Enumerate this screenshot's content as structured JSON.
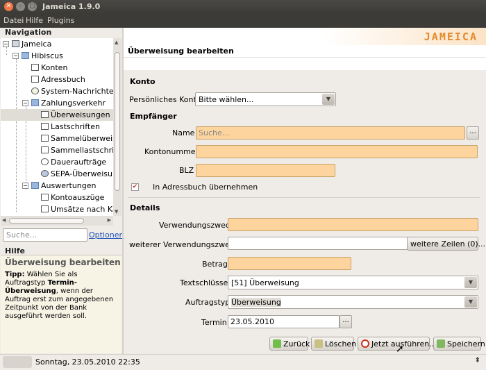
{
  "window": {
    "title": "Jameica 1.9.0"
  },
  "menu": [
    "Datei",
    "Hilfe",
    "Plugins"
  ],
  "navigation": {
    "heading": "Navigation",
    "tree": [
      {
        "label": "Jameica",
        "level": 0,
        "icon": "computer-icon"
      },
      {
        "label": "Hibiscus",
        "level": 1,
        "icon": "folder-icon"
      },
      {
        "label": "Konten",
        "level": 2,
        "icon": "accounts-icon"
      },
      {
        "label": "Adressbuch",
        "level": 2,
        "icon": "addressbook-icon"
      },
      {
        "label": "System-Nachrichten",
        "level": 2,
        "icon": "bulb-icon"
      },
      {
        "label": "Zahlungsverkehr",
        "level": 2,
        "icon": "folder-icon"
      },
      {
        "label": "Überweisungen",
        "level": 3,
        "icon": "transfer-icon",
        "selected": true
      },
      {
        "label": "Lastschriften",
        "level": 3,
        "icon": "debit-icon"
      },
      {
        "label": "Sammelüberweisungen",
        "level": 3,
        "icon": "collective-transfer-icon"
      },
      {
        "label": "Sammellastschriften",
        "level": 3,
        "icon": "collective-debit-icon"
      },
      {
        "label": "Daueraufträge",
        "level": 3,
        "icon": "clock-icon"
      },
      {
        "label": "SEPA-Überweisungen",
        "level": 3,
        "icon": "sepa-icon"
      },
      {
        "label": "Auswertungen",
        "level": 2,
        "icon": "folder-icon"
      },
      {
        "label": "Kontoauszüge",
        "level": 3,
        "icon": "statement-icon"
      },
      {
        "label": "Umsätze nach Kategorien",
        "level": 3,
        "icon": "revenue-icon"
      }
    ],
    "search_placeholder": "Suche...",
    "options_label": "Optionen"
  },
  "help": {
    "heading": "Hilfe",
    "title": "Überweisung bearbeiten",
    "tip_label": "Tipp:",
    "tip_text_1": " Wählen Sie als Auftragstyp ",
    "tip_bold": "Termin-Überweisung",
    "tip_text_2": ", wenn der Auftrag erst zum angegebenen Zeitpunkt von der Bank ausgeführt werden soll."
  },
  "brand": {
    "logo": "JAMEICA"
  },
  "page": {
    "title": "Überweisung bearbeiten",
    "konto": {
      "heading": "Konto",
      "label": "Persönliches Konto",
      "value": "Bitte wählen..."
    },
    "empfaenger": {
      "heading": "Empfänger",
      "name_label": "Name",
      "name_placeholder": "Suche...",
      "name_button": "...",
      "kontonummer_label": "Kontonummer",
      "kontonummer_value": "",
      "blz_label": "BLZ",
      "blz_value": "",
      "addressbook_checkbox": "In Adressbuch übernehmen",
      "addressbook_checked": true
    },
    "details": {
      "heading": "Details",
      "verwendungszweck_label": "Verwendungszweck",
      "verwendungszweck_value": "",
      "weiterer_label": "weiterer Verwendungszweck",
      "weiterer_value": "",
      "weitere_zeilen_button": "weitere Zeilen (0)...",
      "betrag_label": "Betrag",
      "betrag_value": "",
      "textschluessel_label": "Textschlüssel",
      "textschluessel_value": "[51] Überweisung",
      "auftragstyp_label": "Auftragstyp",
      "auftragstyp_value": "Überweisung",
      "termin_label": "Termin",
      "termin_value": "23.05.2010",
      "termin_button": "..."
    },
    "buttons": {
      "zurueck": "Zurück",
      "loeschen": "Löschen",
      "ausfuehren": "Jetzt ausführen...",
      "speichern": "Speichern"
    }
  },
  "status": {
    "text": "Sonntag, 23.05.2010 22:35",
    "right_icon": "⇞"
  },
  "colors": {
    "required_field": "#fdd49d",
    "accent": "#e48a2b",
    "link": "#1d52b8"
  }
}
